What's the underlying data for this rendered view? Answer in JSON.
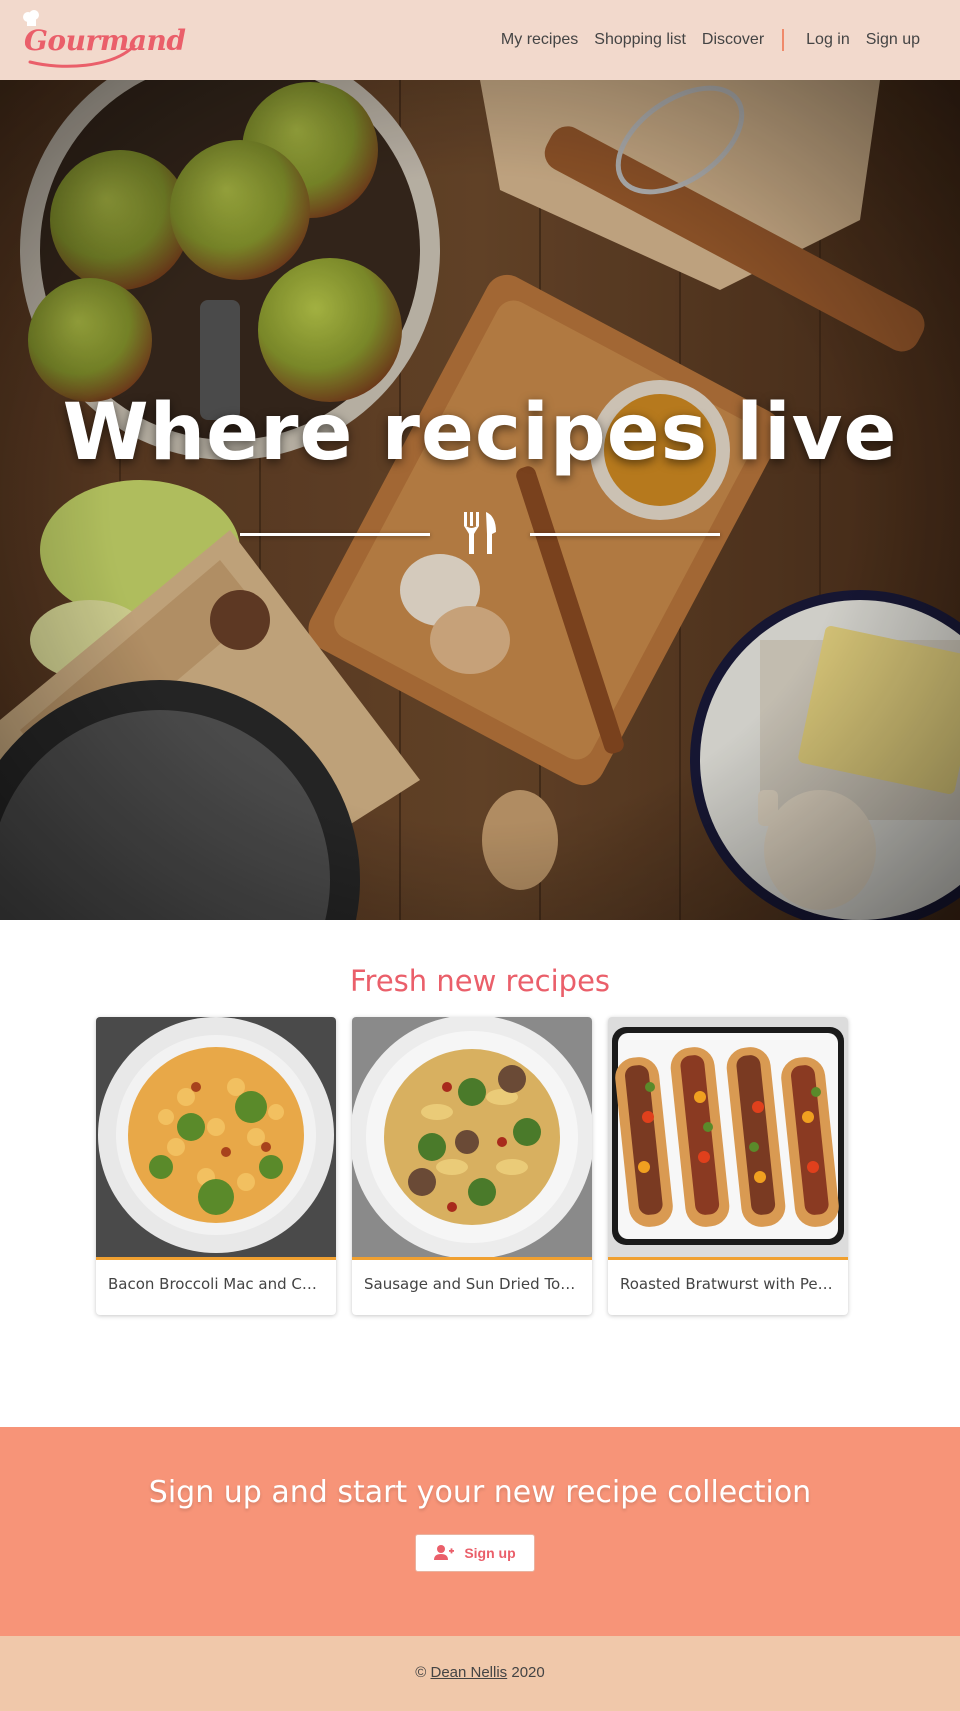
{
  "header": {
    "logo_text": "Gourmand",
    "nav": {
      "my_recipes": "My recipes",
      "shopping_list": "Shopping list",
      "discover": "Discover",
      "log_in": "Log in",
      "sign_up": "Sign up"
    }
  },
  "hero": {
    "title": "Where recipes live",
    "icon": "utensils-icon"
  },
  "fresh": {
    "title": "Fresh new recipes",
    "cards": [
      {
        "title": "Bacon Broccoli Mac and Cheese"
      },
      {
        "title": "Sausage and Sun Dried Tomato Pasta"
      },
      {
        "title": "Roasted Bratwurst with Peppers"
      }
    ]
  },
  "cta": {
    "title": "Sign up and start your new recipe collection",
    "button_label": "Sign up",
    "button_icon": "user-plus-icon"
  },
  "footer": {
    "copyright_symbol": "©",
    "author": "Dean Nellis",
    "year": "2020"
  },
  "colors": {
    "header_bg": "#f2d9cc",
    "brand": "#ea5f6a",
    "cta_bg": "#f79478",
    "footer_bg": "#f0c8aa",
    "card_accent": "#f0a030"
  }
}
